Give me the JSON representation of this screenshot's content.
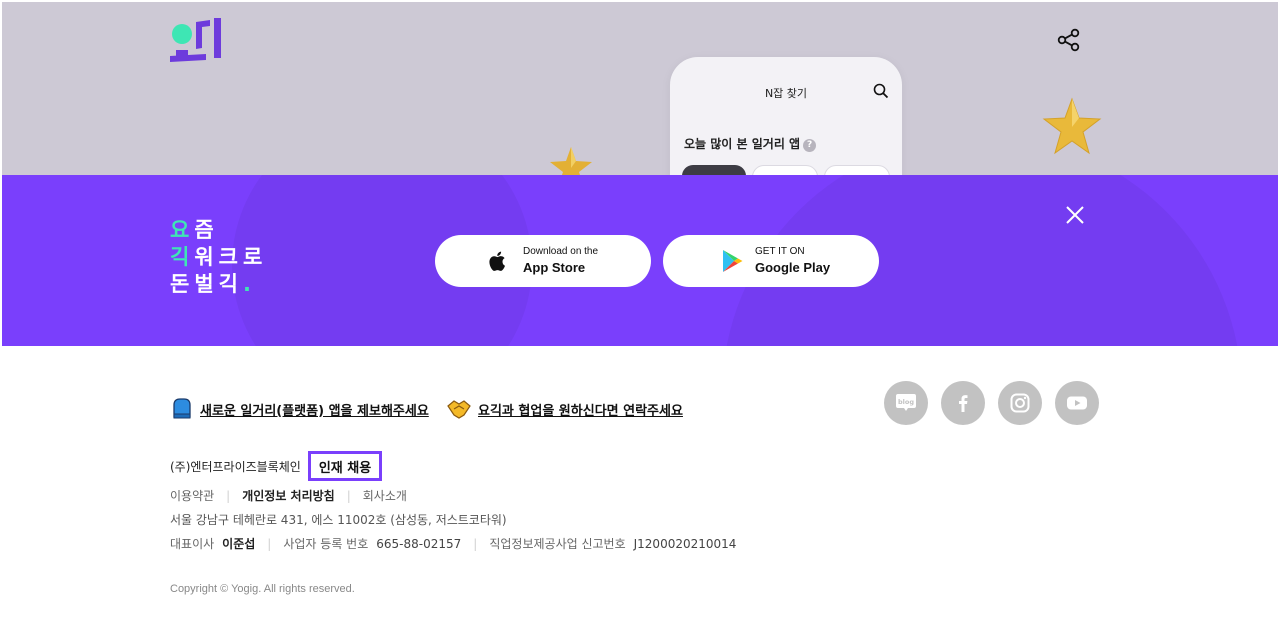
{
  "hero": {
    "logo_alt": "요긱",
    "phone_title": "N잡 찾기",
    "phone_heading": "오늘 많이 본 일거리 앱",
    "phone_help": "?"
  },
  "banner": {
    "slogan": {
      "line1_accent": "요",
      "line1_rest": "즘",
      "line2_accent": "긱",
      "line2_rest": "워크로",
      "line3_rest": "돈벌긱",
      "line3_dot": "."
    },
    "app_store": {
      "small": "Download on the",
      "big": "App Store"
    },
    "google_play": {
      "small": "GET IT ON",
      "big": "Google Play"
    }
  },
  "footer": {
    "link_suggest": "새로운 일거리(플랫폼) 앱을 제보해주세요",
    "link_partner": "요긱과 협업을 원하신다면 연락주세요",
    "social": [
      "blog",
      "facebook",
      "instagram",
      "youtube"
    ],
    "company_name": "(주)엔터프라이즈블록체인",
    "recruit": "인재 채용",
    "links": {
      "terms": "이용약관",
      "privacy": "개인정보 처리방침",
      "about": "회사소개"
    },
    "address": "서울 강남구 테헤란로 431, 에스 11002호 (삼성동, 저스트코타워)",
    "ceo_label": "대표이사",
    "ceo_name": "이준섭",
    "biz_label": "사업자 등록 번호",
    "biz_number": "665-88-02157",
    "job_label": "직업정보제공사업 신고번호",
    "job_number": "J1200020210014",
    "copyright": "Copyright © Yogig. All rights reserved."
  },
  "colors": {
    "brand_purple": "#7a3ffc",
    "accent_mint": "#3ee6b4",
    "hero_bg": "#cdc9d5",
    "social_gray": "#c2c2c2"
  }
}
